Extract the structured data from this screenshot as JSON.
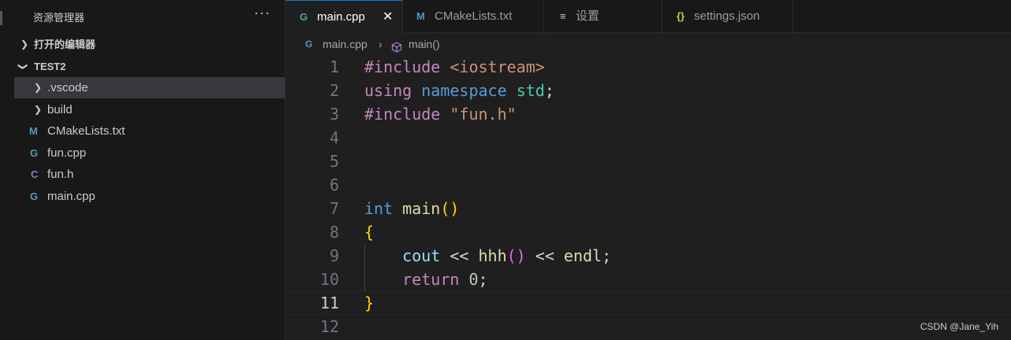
{
  "sidebar": {
    "title": "资源管理器",
    "more": "···",
    "open_editors": "打开的编辑器",
    "project": "TEST2",
    "items": [
      {
        "label": ".vscode",
        "type": "folder"
      },
      {
        "label": "build",
        "type": "folder"
      },
      {
        "label": "CMakeLists.txt",
        "type": "cmake",
        "icon": "M"
      },
      {
        "label": "fun.cpp",
        "type": "cpp",
        "icon": "G"
      },
      {
        "label": "fun.h",
        "type": "header",
        "icon": "C"
      },
      {
        "label": "main.cpp",
        "type": "cpp",
        "icon": "G"
      }
    ]
  },
  "tabs": [
    {
      "label": "main.cpp",
      "icon": "G",
      "close": "✕"
    },
    {
      "label": "CMakeLists.txt",
      "icon": "M"
    },
    {
      "label": "设置",
      "icon": "≡"
    },
    {
      "label": "settings.json",
      "icon": "{}"
    }
  ],
  "breadcrumb": {
    "file": "main.cpp",
    "sep": "›",
    "symbol": "main()"
  },
  "code": {
    "line_numbers": [
      "1",
      "2",
      "3",
      "4",
      "5",
      "6",
      "7",
      "8",
      "9",
      "10",
      "11",
      "12"
    ],
    "current_line": "11"
  },
  "watermark": "CSDN @Jane_Yih",
  "colors": {
    "accent": "#0078d4",
    "cpp_icon": "#519aba",
    "cmake_icon": "#519aba",
    "header_icon": "#a074c4",
    "json_icon": "#cbcb41"
  }
}
